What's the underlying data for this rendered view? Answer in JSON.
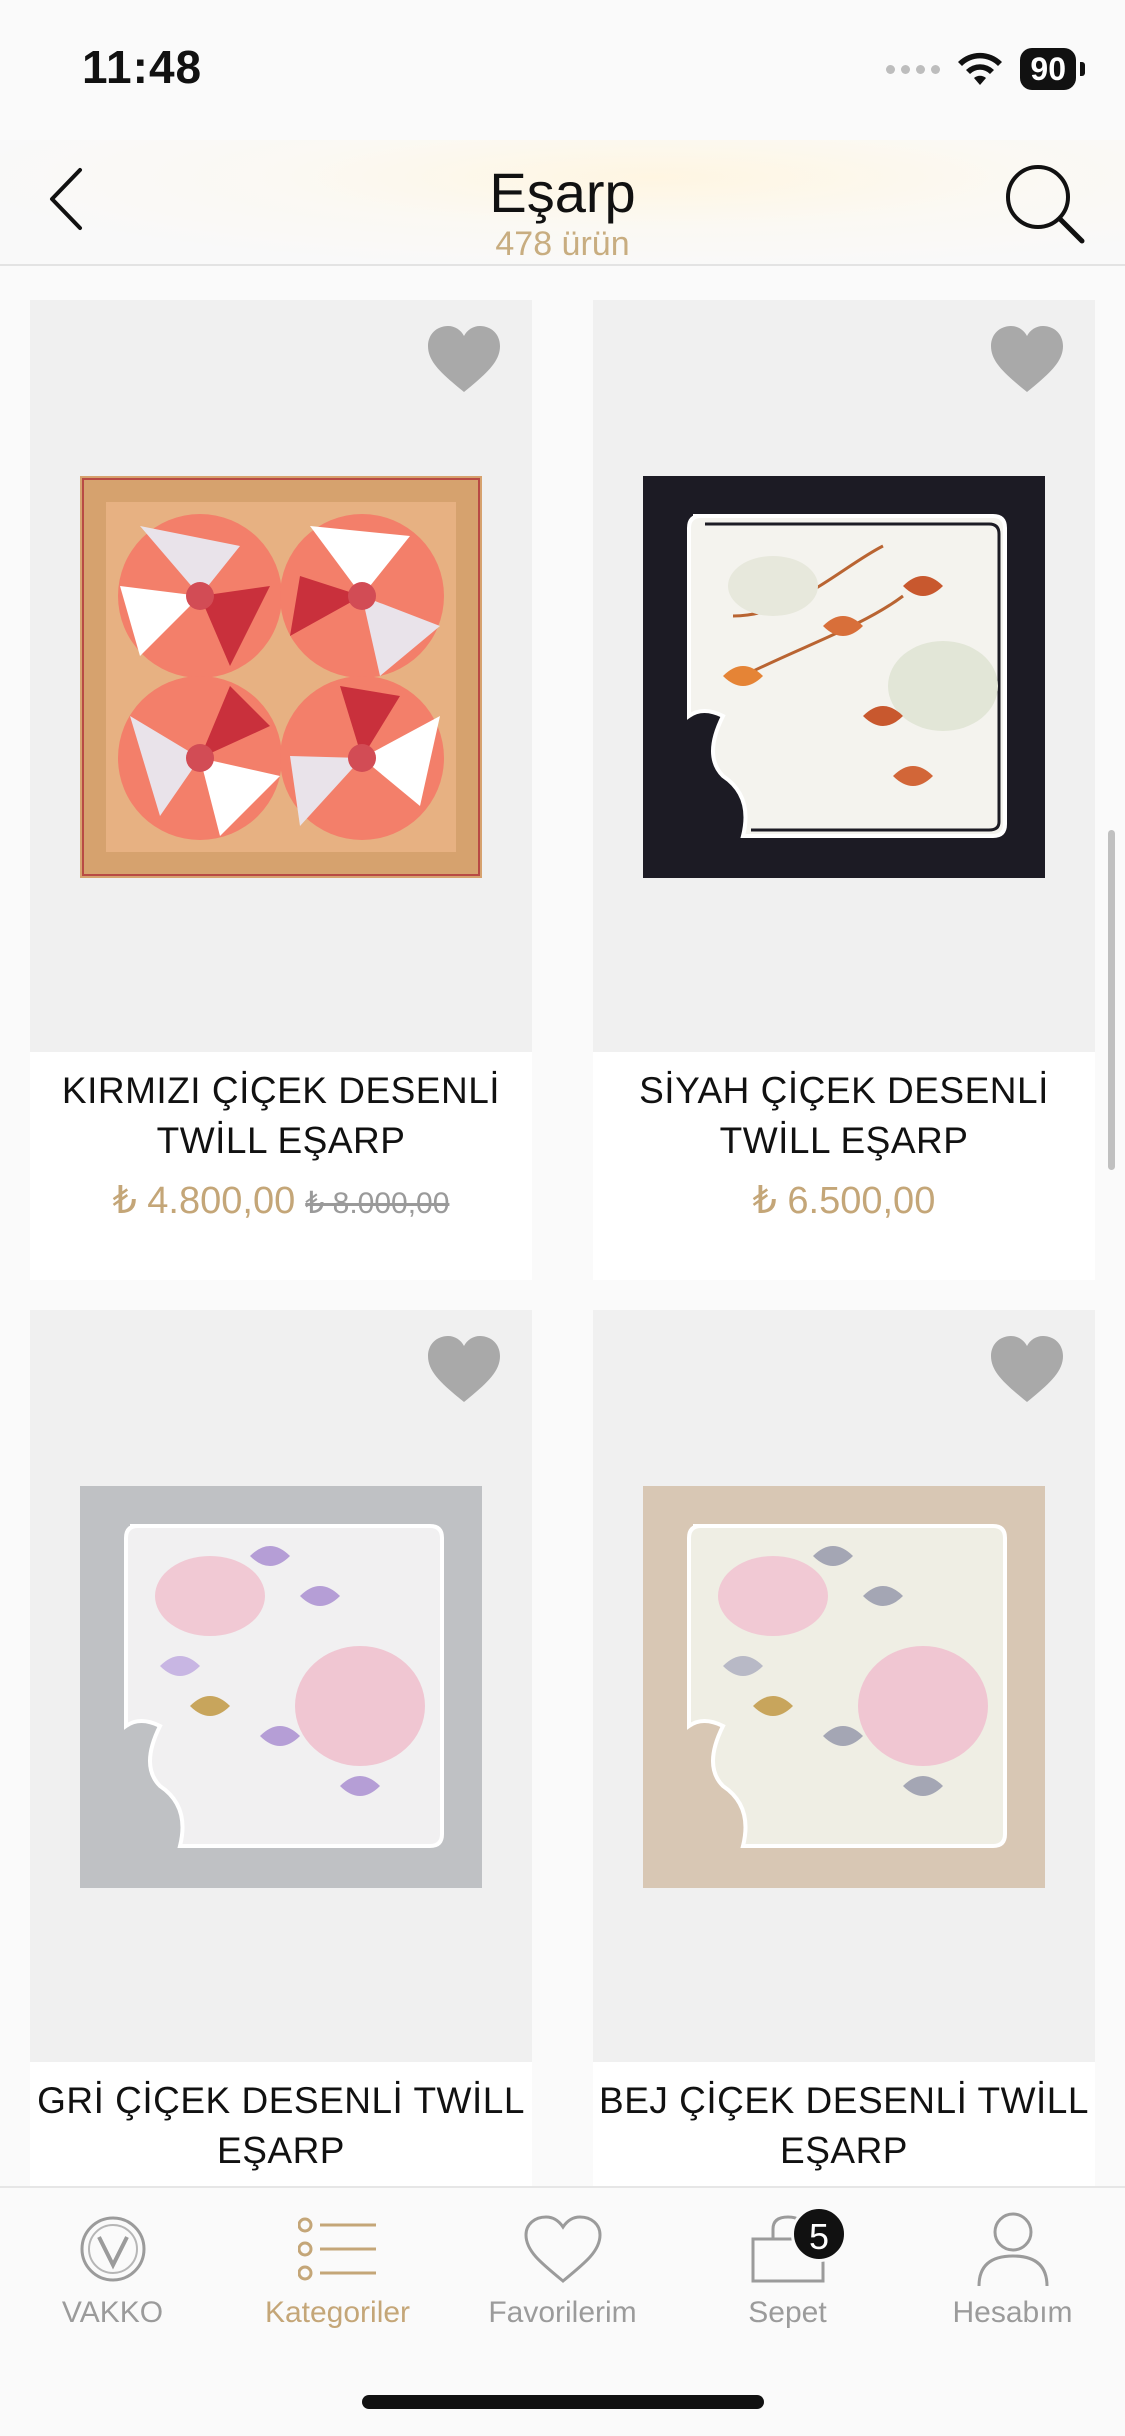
{
  "status": {
    "time": "11:48",
    "battery": "90"
  },
  "header": {
    "title": "Eşarp",
    "subtitle": "478 ürün"
  },
  "products": [
    {
      "name": "KIRMIZI ÇİÇEK DESENLİ TWİLL EŞARP",
      "price": "₺ 4.800,00",
      "old_price": "₺ 8.000,00"
    },
    {
      "name": "SİYAH ÇİÇEK DESENLİ TWİLL EŞARP",
      "price": "₺ 6.500,00",
      "old_price": ""
    },
    {
      "name": "GRİ ÇİÇEK DESENLİ TWİLL EŞARP",
      "price": "",
      "old_price": ""
    },
    {
      "name": "BEJ ÇİÇEK DESENLİ TWİLL EŞARP",
      "price": "",
      "old_price": ""
    }
  ],
  "tabs": [
    {
      "label": "VAKKO",
      "icon": "vakko-logo-icon"
    },
    {
      "label": "Kategoriler",
      "icon": "list-icon",
      "active": true
    },
    {
      "label": "Favorilerim",
      "icon": "heart-icon"
    },
    {
      "label": "Sepet",
      "icon": "bag-icon",
      "badge": "5"
    },
    {
      "label": "Hesabım",
      "icon": "user-icon"
    }
  ],
  "colors": {
    "accent": "#c4a678",
    "fav_heart": "#a9a9a9"
  }
}
